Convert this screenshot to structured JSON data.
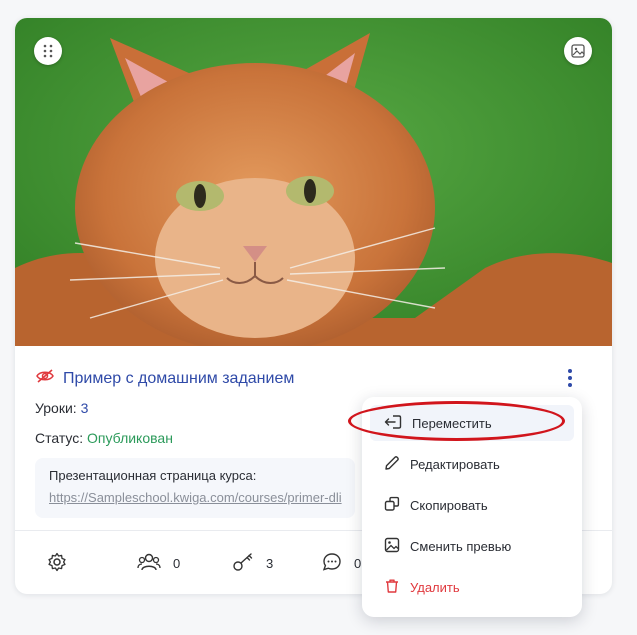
{
  "course": {
    "title": "Пример с домашним заданием",
    "lessons_label": "Уроки:",
    "lessons_value": "3",
    "status_label": "Статус:",
    "status_value": "Опубликован",
    "presentation_label": "Презентационная страница курса:",
    "presentation_url": "https://Sampleschool.kwiga.com/courses/primer-dli",
    "cover_icons": {
      "drag": "drag-dots-icon",
      "change_image": "image-icon"
    },
    "hidden_icon": "eye-off-icon"
  },
  "stats": [
    {
      "icon": "gear-icon",
      "value": ""
    },
    {
      "icon": "users-icon",
      "value": "0"
    },
    {
      "icon": "key-icon",
      "value": "3"
    },
    {
      "icon": "comment-icon",
      "value": "0"
    }
  ],
  "menu": {
    "items": [
      {
        "icon": "move-icon",
        "label": "Переместить"
      },
      {
        "icon": "pencil-icon",
        "label": "Редактировать"
      },
      {
        "icon": "copy-icon",
        "label": "Скопировать"
      },
      {
        "icon": "image-icon",
        "label": "Сменить превью"
      },
      {
        "icon": "trash-icon",
        "label": "Удалить"
      }
    ]
  },
  "colors": {
    "accent": "#2f4aa8",
    "published": "#2b9a5a",
    "danger": "#e0393e",
    "highlight": "#d1151c"
  }
}
